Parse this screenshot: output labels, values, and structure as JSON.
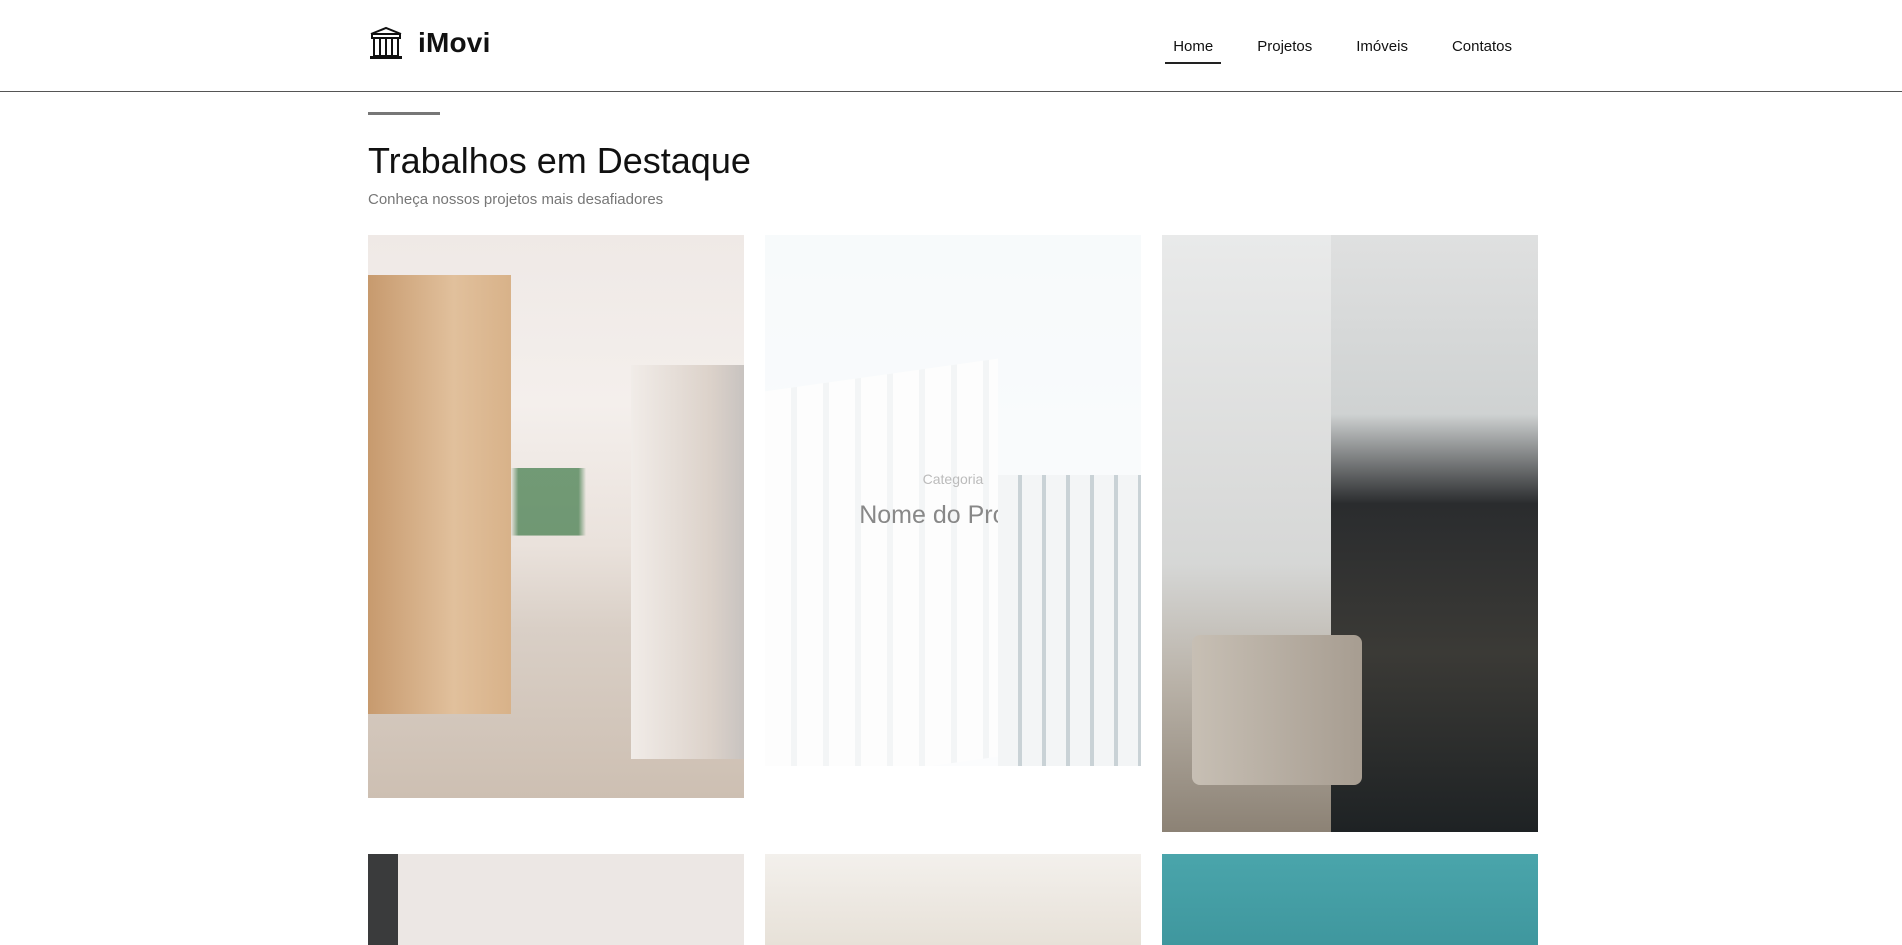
{
  "header": {
    "brand_name": "iMovi",
    "brand_icon": "building-icon",
    "nav": [
      {
        "label": "Home",
        "active": true
      },
      {
        "label": "Projetos",
        "active": false
      },
      {
        "label": "Imóveis",
        "active": false
      },
      {
        "label": "Contatos",
        "active": false
      }
    ]
  },
  "section": {
    "title": "Trabalhos em Destaque",
    "subtitle": "Conheça nossos projetos mais desafiadores"
  },
  "projects": [
    {
      "image": "kitchen-photo"
    },
    {
      "image": "building-photo",
      "category": "Categoria",
      "name": "Nome do Projeto",
      "hovered": true
    },
    {
      "image": "staircase-photo"
    },
    {
      "image": "interior-photo"
    },
    {
      "image": "room-photo"
    },
    {
      "image": "teal-photo"
    }
  ],
  "colors": {
    "accent_line": "#777777",
    "header_border": "#555555",
    "subtitle": "#777777"
  }
}
